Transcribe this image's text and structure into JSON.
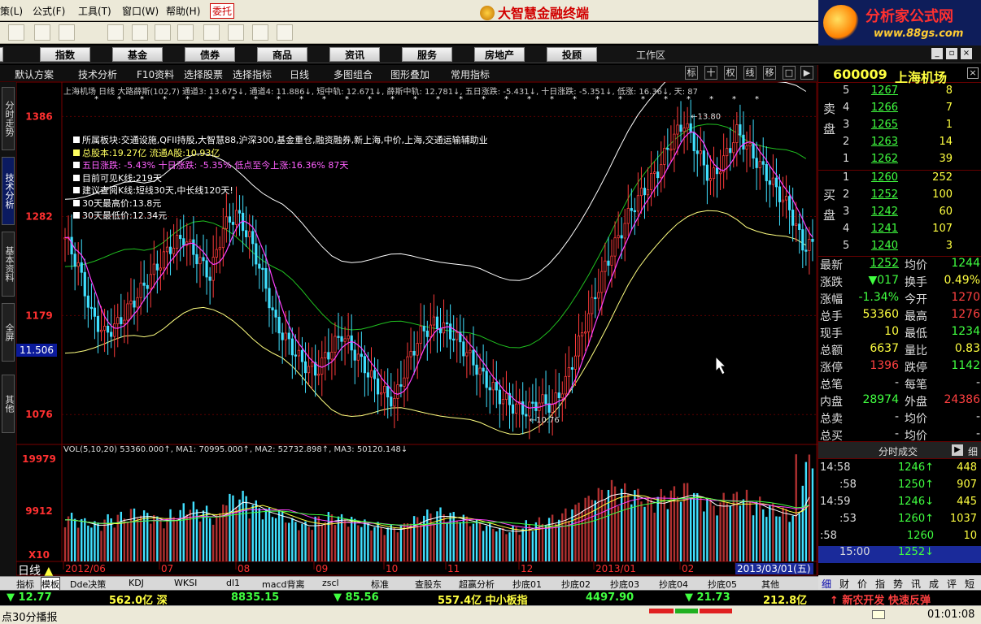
{
  "menubar": {
    "items": [
      "策(L)",
      "公式(F)",
      "工具(T)",
      "窗口(W)",
      "帮助(H)",
      "委托"
    ],
    "app_title": "大智慧金融终端"
  },
  "brand": {
    "name": "分析家公式网",
    "url": "www.88gs.com"
  },
  "nav": {
    "items": [
      "指数",
      "基金",
      "债券",
      "商品",
      "资讯",
      "服务",
      "房地产",
      "投顾"
    ],
    "workarea": "工作区"
  },
  "subbar": {
    "items": [
      "默认方案",
      "技术分析",
      "F10资料",
      "选择股票",
      "选择指标",
      "日线",
      "多图组合",
      "图形叠加",
      "常用指标"
    ],
    "buttons": [
      "标",
      "十",
      "权",
      "线",
      "移",
      "□",
      "▶"
    ]
  },
  "left_tabs": [
    "分时走势",
    "技术分析",
    "基本资料",
    "全屏",
    "其他"
  ],
  "chart": {
    "header_line": "上海机场 日线  大路薛斯(102,7) 通道3: 13.675↓, 通道4: 11.886↓, 短中轨: 12.671↓, 薛斯中轨: 12.781↓, 五日涨跌: -5.431↓, 十日涨跌: -5.351↓, 低涨: 16.36↓, 天: 87",
    "info_lines": [
      "所属板块:交通设施,QFII持股,大智慧88,沪深300,基金重仓,融资融券,新上海,中价,上海,交通运输辅助业",
      "总股本:19.27亿   流通A股:10.93亿",
      "五日涨跌: -5.43%     十日涨跌: -5.35%   低点至今上涨:16.36%    87天",
      "目前可见K线:219天",
      "建议查阅K线:短线30天,中长线120天!",
      "30天最高价:13.8元",
      "30天最低价:12.34元"
    ],
    "y_ticks": [
      "1386",
      "1282",
      "1179",
      "1076"
    ],
    "cursor_value": "11.506",
    "high_annotation": "13.80",
    "low_annotation": "10.76",
    "vol_header": "VOL(5,10,20)  53360.000↑, MA1: 70995.000↑, MA2: 52732.898↑, MA3: 50120.148↓",
    "vol_ticks": [
      "19979",
      "9912",
      "X10"
    ],
    "period_label": "日线",
    "x_labels": [
      "2012/06",
      "07",
      "08",
      "09",
      "10",
      "11",
      "12",
      "2013/01",
      "02",
      "2013/03/01(五)"
    ]
  },
  "stock": {
    "code": "600009",
    "name": "上海机场",
    "sell_label": "卖盘",
    "buy_label": "买盘",
    "sell": [
      {
        "lv": "5",
        "price": "1267",
        "vol": "8"
      },
      {
        "lv": "4",
        "price": "1266",
        "vol": "7"
      },
      {
        "lv": "3",
        "price": "1265",
        "vol": "1"
      },
      {
        "lv": "2",
        "price": "1263",
        "vol": "14"
      },
      {
        "lv": "1",
        "price": "1262",
        "vol": "39"
      }
    ],
    "buy": [
      {
        "lv": "1",
        "price": "1260",
        "vol": "252"
      },
      {
        "lv": "2",
        "price": "1252",
        "vol": "100"
      },
      {
        "lv": "3",
        "price": "1242",
        "vol": "60"
      },
      {
        "lv": "4",
        "price": "1241",
        "vol": "107"
      },
      {
        "lv": "5",
        "price": "1240",
        "vol": "3"
      }
    ],
    "info": [
      {
        "k1": "最新",
        "v1": "1252",
        "c1": "#40ff40",
        "k2": "均价",
        "v2": "1244",
        "c2": "#40ff40"
      },
      {
        "k1": "涨跌",
        "v1": "▼017",
        "c1": "#40ff40",
        "k2": "换手",
        "v2": "0.49%",
        "c2": "#ffff40"
      },
      {
        "k1": "涨幅",
        "v1": "-1.34%",
        "c1": "#40ff40",
        "k2": "今开",
        "v2": "1270",
        "c2": "#ff4040"
      },
      {
        "k1": "总手",
        "v1": "53360",
        "c1": "#ffff40",
        "k2": "最高",
        "v2": "1276",
        "c2": "#ff4040"
      },
      {
        "k1": "现手",
        "v1": "10",
        "c1": "#ffff40",
        "k2": "最低",
        "v2": "1234",
        "c2": "#40ff40"
      },
      {
        "k1": "总额",
        "v1": "6637",
        "c1": "#ffff40",
        "k2": "量比",
        "v2": "0.83",
        "c2": "#ffff40"
      },
      {
        "k1": "涨停",
        "v1": "1396",
        "c1": "#ff4040",
        "k2": "跌停",
        "v2": "1142",
        "c2": "#40ff40"
      },
      {
        "k1": "总笔",
        "v1": "-",
        "c1": "#ddd",
        "k2": "每笔",
        "v2": "-",
        "c2": "#ddd"
      },
      {
        "k1": "内盘",
        "v1": "28974",
        "c1": "#40ff40",
        "k2": "外盘",
        "v2": "24386",
        "c2": "#ff4040"
      },
      {
        "k1": "总卖",
        "v1": "-",
        "c1": "#ddd",
        "k2": "均价",
        "v2": "-",
        "c2": "#ddd"
      },
      {
        "k1": "总买",
        "v1": "-",
        "c1": "#ddd",
        "k2": "均价",
        "v2": "-",
        "c2": "#ddd"
      }
    ],
    "ticks_header": "分时成交",
    "ticks_btn": "细",
    "ticks": [
      {
        "t": "14:58",
        "p": "1246↑",
        "pc": "#40ff40",
        "v": "448"
      },
      {
        "t": ":58",
        "p": "1250↑",
        "pc": "#40ff40",
        "v": "907"
      },
      {
        "t": "14:59",
        "p": "1246↓",
        "pc": "#40ff40",
        "v": "445"
      },
      {
        "t": ":53",
        "p": "1260↑",
        "pc": "#40ff40",
        "v": "1037"
      },
      {
        "t": ":58",
        "p": "1260",
        "pc": "#40ff40",
        "v": "10"
      },
      {
        "t": "15:00",
        "p": "1252↓",
        "pc": "#40ff40",
        "v": ""
      }
    ],
    "tabs": [
      "细",
      "财",
      "价",
      "指",
      "势",
      "讯",
      "成",
      "评",
      "短"
    ]
  },
  "bottom_tabs": [
    "指标",
    "模板",
    "Dde决策",
    "KDJ",
    "WKSI",
    "dl1",
    "macd背离",
    "zscl",
    "标准",
    "查股东",
    "超赢分析",
    "抄底01",
    "抄底02",
    "抄底03",
    "抄底04",
    "抄底05",
    "其他"
  ],
  "ticker": [
    {
      "t": "▼ 12.77",
      "c": "#40ff40"
    },
    {
      "t": "562.0亿 深",
      "c": "#ffff40"
    },
    {
      "t": "8835.15",
      "c": "#40ff40"
    },
    {
      "t": "▼ 85.56",
      "c": "#40ff40"
    },
    {
      "t": "557.4亿 中小板指",
      "c": "#ffff40"
    },
    {
      "t": "4497.90",
      "c": "#40ff40"
    },
    {
      "t": "▼ 21.73",
      "c": "#40ff40"
    },
    {
      "t": "212.8亿",
      "c": "#ffff40"
    },
    {
      "t": "↑ 新农开发 快速反弹",
      "c": "#ff4040"
    }
  ],
  "status": {
    "left": "点30分播报",
    "time": "01:01:08"
  },
  "colors": {
    "up": "#ff3b3b",
    "down": "#40e0ff",
    "ma5": "#ff40ff",
    "band_upper": "#ffffff",
    "band_mid": "#20c020",
    "band_lower": "#ffff80"
  },
  "chart_data": {
    "type": "candlestick",
    "title": "上海机场 日线",
    "ylim": [
      10.5,
      14.1
    ],
    "close_series": [
      12.6,
      12.3,
      11.8,
      11.6,
      11.7,
      11.9,
      12.1,
      12.3,
      12.5,
      12.6,
      12.4,
      12.2,
      12.7,
      12.85,
      12.6,
      12.2,
      11.7,
      11.5,
      11.3,
      11.2,
      11.4,
      11.6,
      11.4,
      11.2,
      11.0,
      10.9,
      11.3,
      11.6,
      11.7,
      11.65,
      11.5,
      11.3,
      11.1,
      10.95,
      10.85,
      10.8,
      10.9,
      10.85,
      11.1,
      11.5,
      11.9,
      12.3,
      12.6,
      12.9,
      13.1,
      13.3,
      13.6,
      13.8,
      13.5,
      13.2,
      13.4,
      13.7,
      13.5,
      13.3,
      13.1,
      12.9,
      12.52
    ],
    "volume_series": [
      9.1,
      8.2,
      7.6,
      8.8,
      9.3,
      10.1,
      9.6,
      8.4,
      9.8,
      11.2,
      10.4,
      9.1,
      12.8,
      13.2,
      11.4,
      10.2,
      9.7,
      8.1,
      7.5,
      8.6,
      9.3,
      8.8,
      8.0,
      7.4,
      6.9,
      7.2,
      8.6,
      9.7,
      10.1,
      9.4,
      8.8,
      7.9,
      7.1,
      6.4,
      6.8,
      7.7,
      8.3,
      9.0,
      10.6,
      12.4,
      13.9,
      15.2,
      14.6,
      13.8,
      12.2,
      13.5,
      14.1,
      15.0,
      12.8,
      11.6,
      12.9,
      13.4,
      12.1,
      11.0,
      10.2,
      9.7,
      19.979
    ]
  }
}
